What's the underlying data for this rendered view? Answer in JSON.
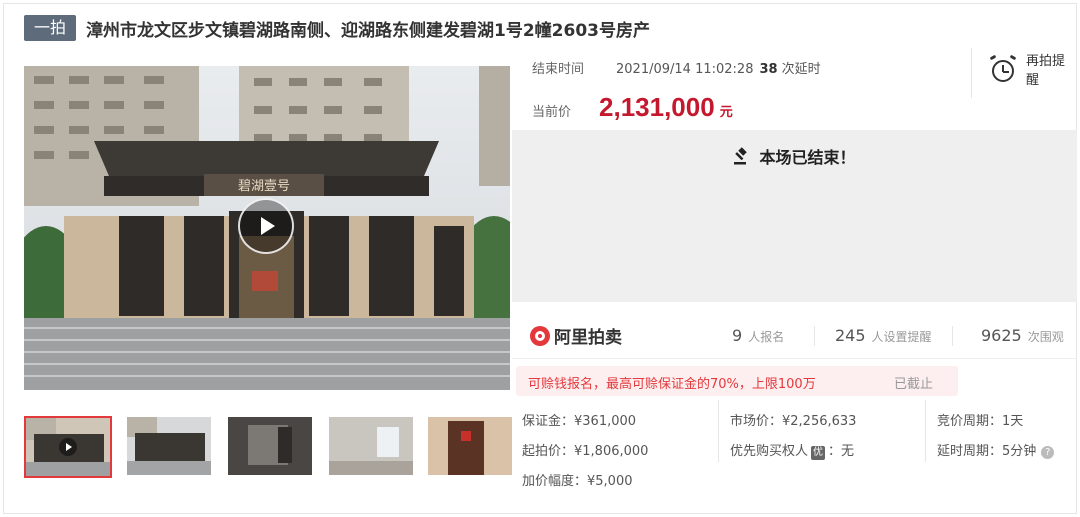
{
  "header": {
    "tag": "一拍",
    "title": "漳州市龙文区步文镇碧湖路南侧、迎湖路东侧建发碧湖1号2幢2603号房产"
  },
  "auction": {
    "end_label": "结束时间",
    "end_time": "2021/09/14 11:02:28",
    "delay_count": "38",
    "delay_unit": "次延时",
    "price_label": "当前价",
    "price": "2,131,000",
    "price_unit": "元",
    "status_text": "本场已结束！"
  },
  "reminder": {
    "label": "再拍提醒",
    "icon": "alarm-clock-icon"
  },
  "platform": {
    "name": "阿里拍卖",
    "registrations": "9",
    "registrations_unit": "人报名",
    "reminders": "245",
    "reminders_unit": "人设置提醒",
    "watchers": "9625",
    "watchers_unit": "次围观"
  },
  "deposit_notice": {
    "message": "可赊钱报名，最高可赊保证金的70%，上限100万",
    "status": "已截止"
  },
  "details": {
    "deposit": "保证金：¥361,000",
    "start_price": "起拍价：¥1,806,000",
    "increment": "加价幅度：¥5,000",
    "market_price": "市场价：¥2,256,633",
    "priority_label": "优先购买权人",
    "priority_badge": "优",
    "priority_value": "：无",
    "bid_period": "竞价周期：1天",
    "delay_period": "延时周期：5分钟",
    "help": "?"
  },
  "colors": {
    "accent_red": "#c5172e",
    "brand_red": "#e4393c",
    "tag_bg": "#5d6b7a"
  }
}
